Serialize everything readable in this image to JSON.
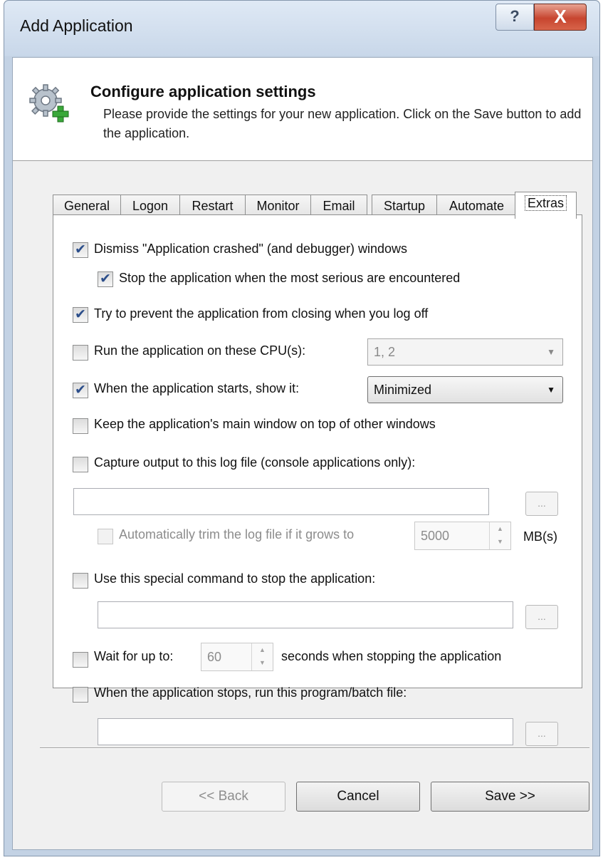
{
  "window": {
    "title": "Add Application",
    "help_label": "?",
    "close_label": "X"
  },
  "header": {
    "title": "Configure application settings",
    "description": "Please provide the settings for your new application. Click on the Save button to add the application.",
    "icon": "gear-add-icon"
  },
  "tabs": [
    {
      "label": "General"
    },
    {
      "label": "Logon"
    },
    {
      "label": "Restart"
    },
    {
      "label": "Monitor"
    },
    {
      "label": "Email"
    },
    {
      "label": "Startup"
    },
    {
      "label": "Automate"
    },
    {
      "label": "Extras",
      "active": true
    }
  ],
  "options": {
    "dismiss_crashed": {
      "label": "Dismiss \"Application crashed\" (and debugger) windows",
      "checked": true
    },
    "stop_on_serious": {
      "label": "Stop the application when the most serious are encountered",
      "checked": true
    },
    "prevent_close_logoff": {
      "label": "Try to prevent the application from closing when you log off",
      "checked": true
    },
    "cpu_affinity": {
      "label": "Run the application on these CPU(s):",
      "checked": false,
      "value": "1, 2"
    },
    "start_show": {
      "label": "When the application starts, show it:",
      "checked": true,
      "value": "Minimized"
    },
    "keep_on_top": {
      "label": "Keep the application's main window on top of other windows",
      "checked": false
    },
    "capture_output": {
      "label": "Capture output to this log file (console applications only):",
      "checked": false,
      "path": ""
    },
    "trim_log": {
      "label": "Automatically trim the log file if it grows to",
      "checked": false,
      "value": "5000",
      "unit": "MB(s)"
    },
    "stop_command": {
      "label": "Use this special command to stop the application:",
      "checked": false,
      "command": ""
    },
    "wait_stop": {
      "label_before": "Wait for up to:",
      "value": "60",
      "label_after": "seconds when stopping the application",
      "checked": false
    },
    "run_on_stop": {
      "label": "When the application stops, run this program/batch file:",
      "checked": false,
      "path": ""
    }
  },
  "browse_label": "...",
  "buttons": {
    "back": "<< Back",
    "cancel": "Cancel",
    "save": "Save >>"
  },
  "colors": {
    "title_bar": "#c8d7e9",
    "close_button": "#c7452f",
    "check_mark": "#2c4e8a"
  }
}
